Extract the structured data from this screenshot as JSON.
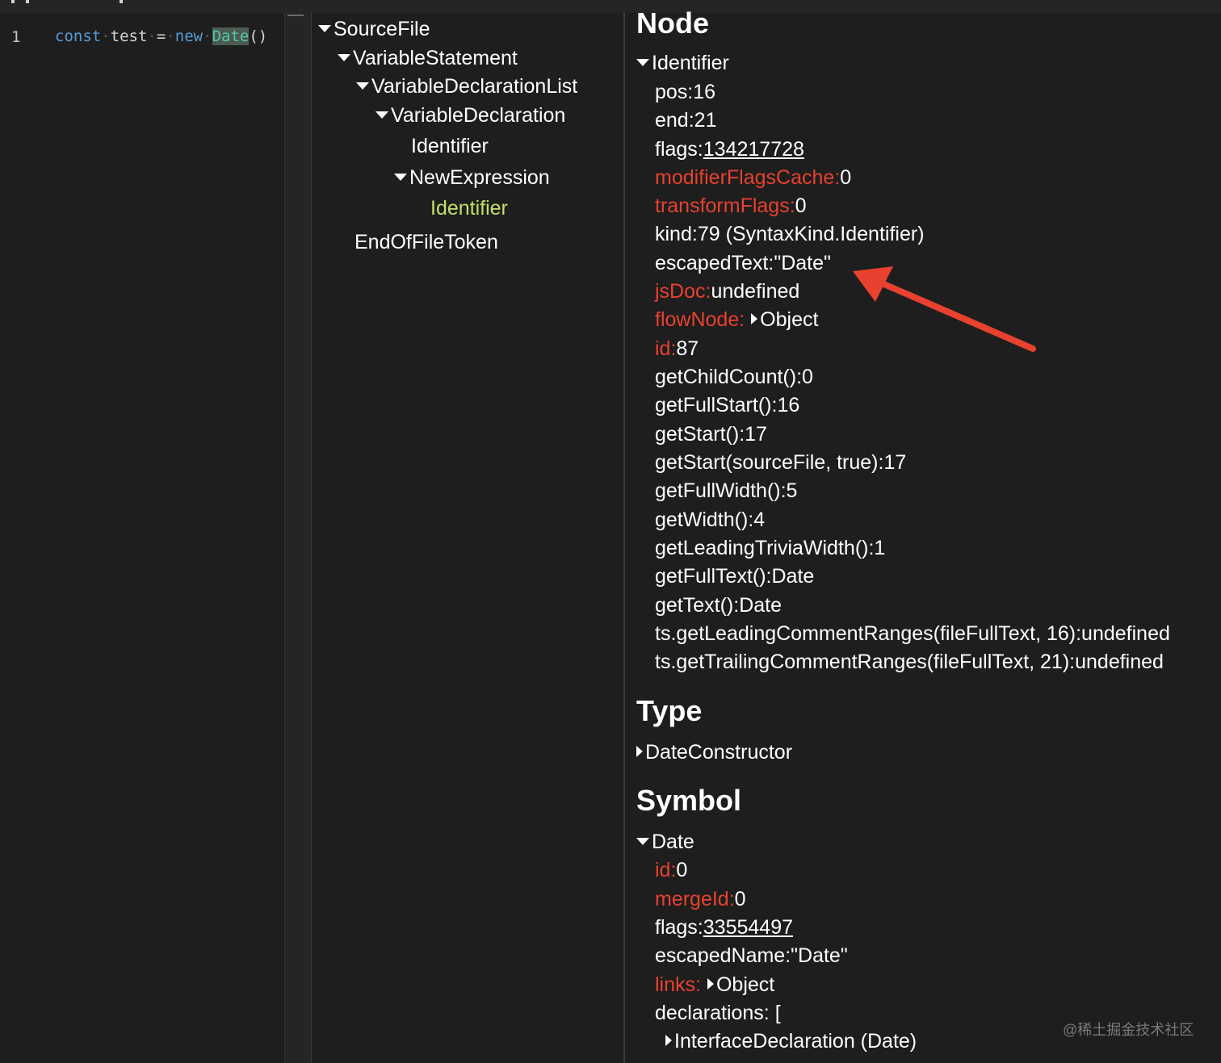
{
  "editor": {
    "line_number": "1",
    "code": {
      "kw1": "const",
      "ident": "test",
      "op": "=",
      "kw2": "new",
      "cls": "Date",
      "parens": "()"
    }
  },
  "tree": {
    "nodes": [
      {
        "label": "SourceFile",
        "expanded": true
      },
      {
        "label": "VariableStatement",
        "expanded": true
      },
      {
        "label": "VariableDeclarationList",
        "expanded": true
      },
      {
        "label": "VariableDeclaration",
        "expanded": true
      },
      {
        "label": "Identifier"
      },
      {
        "label": "NewExpression",
        "expanded": true
      },
      {
        "label": "Identifier",
        "selected": true
      },
      {
        "label": "EndOfFileToken"
      }
    ]
  },
  "node_section": {
    "heading": "Node",
    "root": "Identifier",
    "props": [
      {
        "key": "pos:",
        "value": "16"
      },
      {
        "key": "end:",
        "value": "21"
      },
      {
        "key": "flags:",
        "value": "134217728",
        "link": true
      },
      {
        "key": "modifierFlagsCache:",
        "value": "0",
        "red": true
      },
      {
        "key": "transformFlags:",
        "value": "0",
        "red": true
      },
      {
        "key": "kind:",
        "value": "79 (SyntaxKind.Identifier)"
      },
      {
        "key": "escapedText:",
        "value": "\"Date\""
      },
      {
        "key": "jsDoc:",
        "value": "undefined",
        "red": true
      },
      {
        "key": "flowNode:",
        "value": "Object",
        "red": true,
        "collapsed": true
      },
      {
        "key": "id:",
        "value": "87",
        "red": true
      },
      {
        "key": "getChildCount():",
        "value": "0"
      },
      {
        "key": "getFullStart():",
        "value": "16"
      },
      {
        "key": "getStart():",
        "value": "17"
      },
      {
        "key": "getStart(sourceFile, true):",
        "value": "17"
      },
      {
        "key": "getFullWidth():",
        "value": "5"
      },
      {
        "key": "getWidth():",
        "value": "4"
      },
      {
        "key": "getLeadingTriviaWidth():",
        "value": "1"
      },
      {
        "key": "getFullText():",
        "value": "Date"
      },
      {
        "key": "getText():",
        "value": "Date"
      },
      {
        "key": "ts.getLeadingCommentRanges(fileFullText, 16):",
        "value": "undefined"
      },
      {
        "key": "ts.getTrailingCommentRanges(fileFullText, 21):",
        "value": "undefined"
      }
    ]
  },
  "type_section": {
    "heading": "Type",
    "root": "DateConstructor"
  },
  "symbol_section": {
    "heading": "Symbol",
    "root": "Date",
    "props": [
      {
        "key": "id:",
        "value": "0",
        "red": true
      },
      {
        "key": "mergeId:",
        "value": "0",
        "red": true
      },
      {
        "key": "flags:",
        "value": "33554497",
        "link": true
      },
      {
        "key": "escapedName:",
        "value": "\"Date\""
      },
      {
        "key": "links:",
        "value": "Object",
        "red": true,
        "collapsed": true
      },
      {
        "key": "declarations:",
        "value": "["
      }
    ],
    "declaration_item": "InterfaceDeclaration (Date)"
  },
  "annotation": {
    "arrow_color": "#e8412f"
  },
  "watermark": "@稀土掘金技术社区"
}
